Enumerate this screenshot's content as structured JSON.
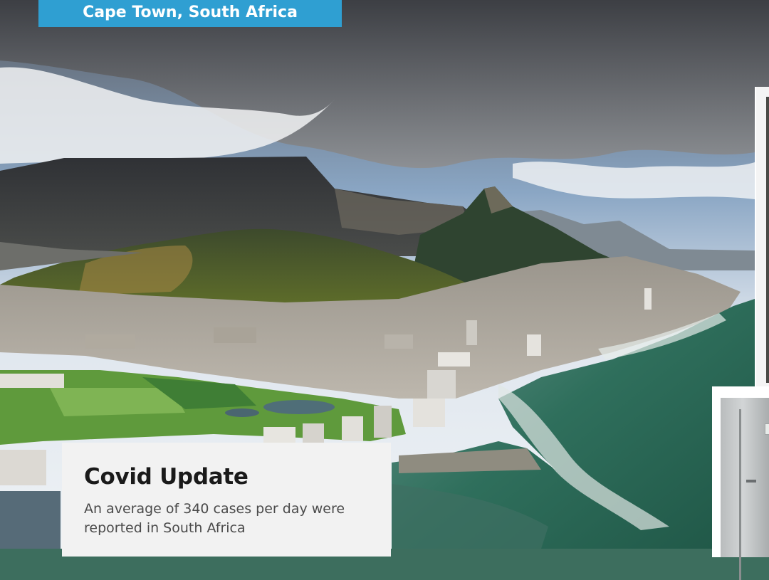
{
  "hero": {
    "location_label": "Cape Town, South Africa"
  },
  "update_card": {
    "title": "Covid Update",
    "body": "An average of 340 cases per day were reported in South Africa"
  },
  "colors": {
    "tag_background": "#2f9fd2",
    "card_background": "#f2f2f2",
    "title_text": "#1a1a1a",
    "body_text": "#4a4a4a"
  }
}
